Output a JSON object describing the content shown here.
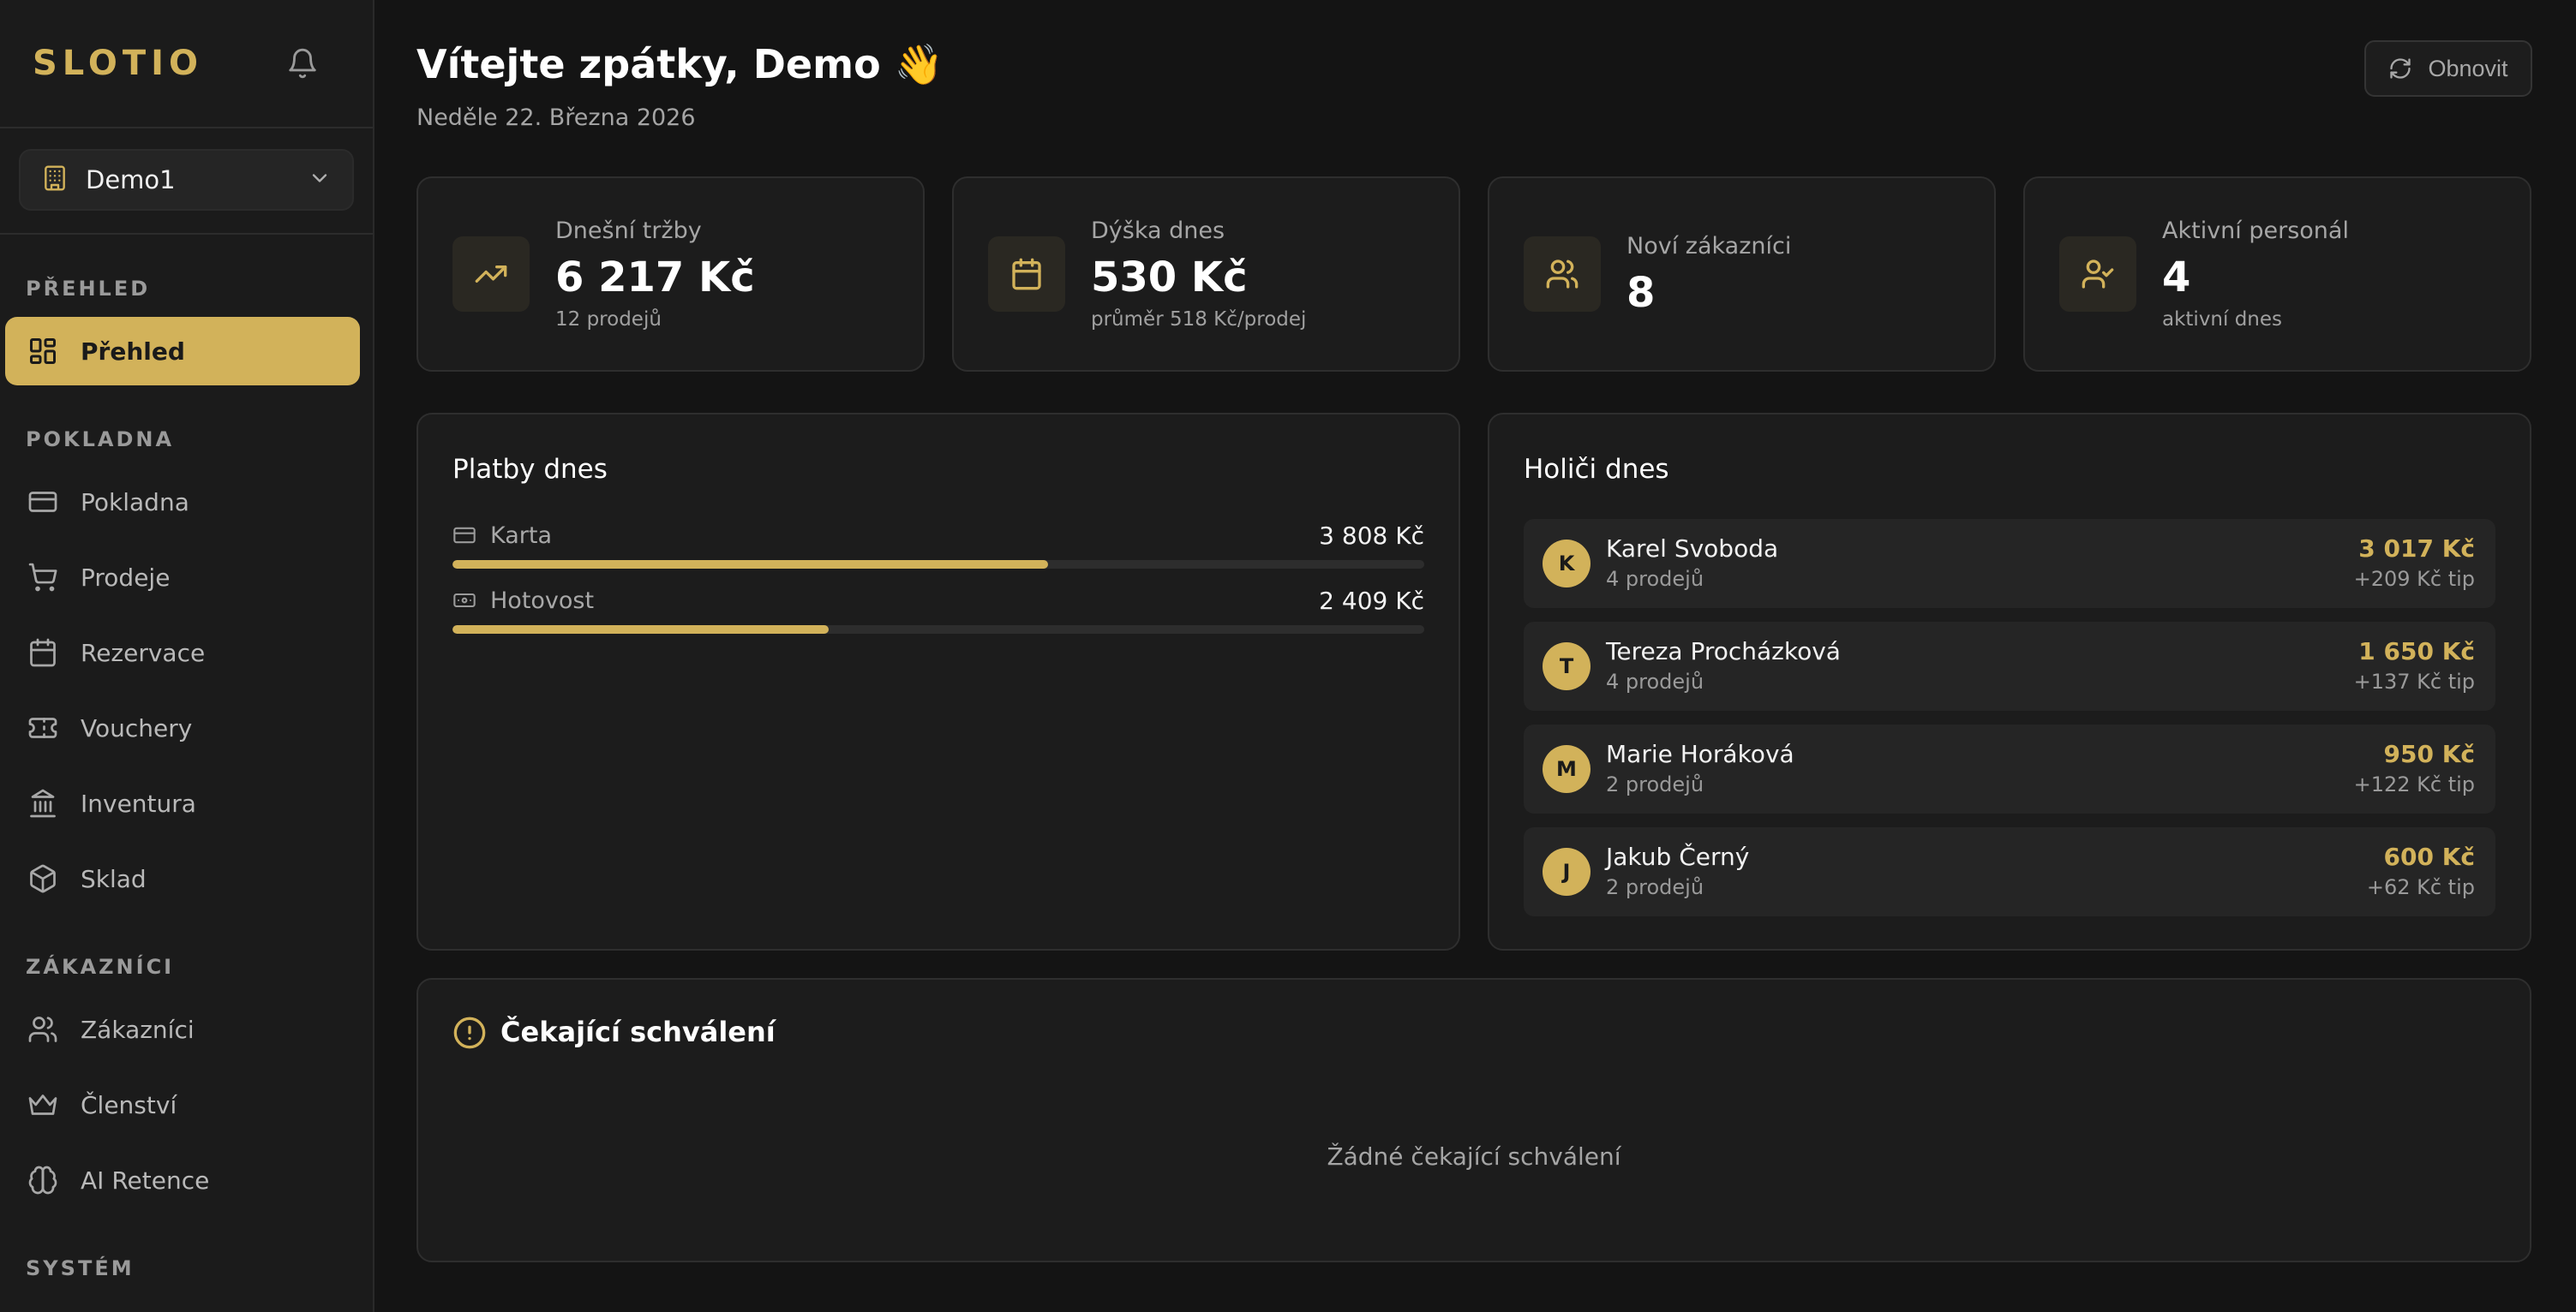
{
  "app": {
    "brand": "SLOTIO"
  },
  "sidebar": {
    "branch": "Demo1",
    "sections": [
      {
        "title": "PŘEHLED"
      },
      {
        "title": "POKLADNA"
      },
      {
        "title": "ZÁKAZNÍCI"
      },
      {
        "title": "SYSTÉM"
      }
    ],
    "items": [
      {
        "label": "Přehled",
        "icon": "dashboard-icon",
        "active": true
      },
      {
        "label": "Pokladna",
        "icon": "credit-card-icon"
      },
      {
        "label": "Prodeje",
        "icon": "cart-icon"
      },
      {
        "label": "Rezervace",
        "icon": "calendar-icon"
      },
      {
        "label": "Vouchery",
        "icon": "ticket-icon"
      },
      {
        "label": "Inventura",
        "icon": "bank-icon"
      },
      {
        "label": "Sklad",
        "icon": "package-icon"
      },
      {
        "label": "Zákazníci",
        "icon": "users-icon"
      },
      {
        "label": "Členství",
        "icon": "crown-icon"
      },
      {
        "label": "AI Retence",
        "icon": "brain-icon"
      }
    ]
  },
  "header": {
    "title": "Vítejte zpátky, Demo 👋",
    "date": "Neděle 22. Března 2026",
    "refresh_label": "Obnovit"
  },
  "stats": [
    {
      "label": "Dnešní tržby",
      "value": "6 217 Kč",
      "sub": "12 prodejů",
      "icon": "trending-up-icon"
    },
    {
      "label": "Dýška dnes",
      "value": "530 Kč",
      "sub": "průměr 518 Kč/prodej",
      "icon": "calendar-icon"
    },
    {
      "label": "Noví zákazníci",
      "value": "8",
      "sub": "",
      "icon": "users-icon"
    },
    {
      "label": "Aktivní personál",
      "value": "4",
      "sub": "aktivní dnes",
      "icon": "user-check-icon"
    }
  ],
  "payments": {
    "title": "Platby dnes",
    "items": [
      {
        "label": "Karta",
        "amount": "3 808 Kč",
        "share": 0.613,
        "icon": "credit-card-icon"
      },
      {
        "label": "Hotovost",
        "amount": "2 409 Kč",
        "share": 0.387,
        "icon": "cash-icon"
      }
    ]
  },
  "barbers": {
    "title": "Holiči dnes",
    "items": [
      {
        "initial": "K",
        "name": "Karel Svoboda",
        "sales": "4 prodejů",
        "amount": "3 017 Kč",
        "tip": "+209 Kč tip"
      },
      {
        "initial": "T",
        "name": "Tereza Procházková",
        "sales": "4 prodejů",
        "amount": "1 650 Kč",
        "tip": "+137 Kč tip"
      },
      {
        "initial": "M",
        "name": "Marie Horáková",
        "sales": "2 prodejů",
        "amount": "950 Kč",
        "tip": "+122 Kč tip"
      },
      {
        "initial": "J",
        "name": "Jakub Černý",
        "sales": "2 prodejů",
        "amount": "600 Kč",
        "tip": "+62 Kč tip"
      }
    ]
  },
  "approvals": {
    "title": "Čekající schválení",
    "empty": "Žádné čekající schválení"
  },
  "colors": {
    "accent": "#d2b25a",
    "background": "#141414",
    "card": "#1c1c1c"
  }
}
